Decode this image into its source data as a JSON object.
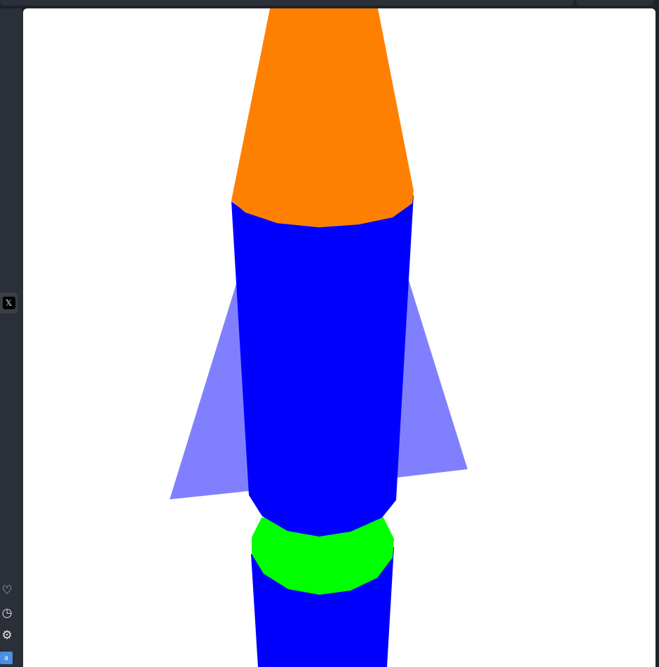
{
  "sidebar": {
    "x_button": {
      "icon": "x-logo-icon",
      "glyph": "𝕏"
    },
    "favorites": {
      "icon": "heart-icon",
      "glyph": "♡"
    },
    "history": {
      "icon": "clock-icon",
      "glyph": "◷"
    },
    "settings": {
      "icon": "gear-icon",
      "glyph": "⚙"
    },
    "translate": {
      "icon": "translate-icon",
      "glyph": "a"
    }
  },
  "scene": {
    "colors": {
      "nose_cone": "#ff8000",
      "body": "#0000ff",
      "fins": "#8080ff",
      "ring": "#00ff00",
      "background": "#ffffff"
    }
  }
}
